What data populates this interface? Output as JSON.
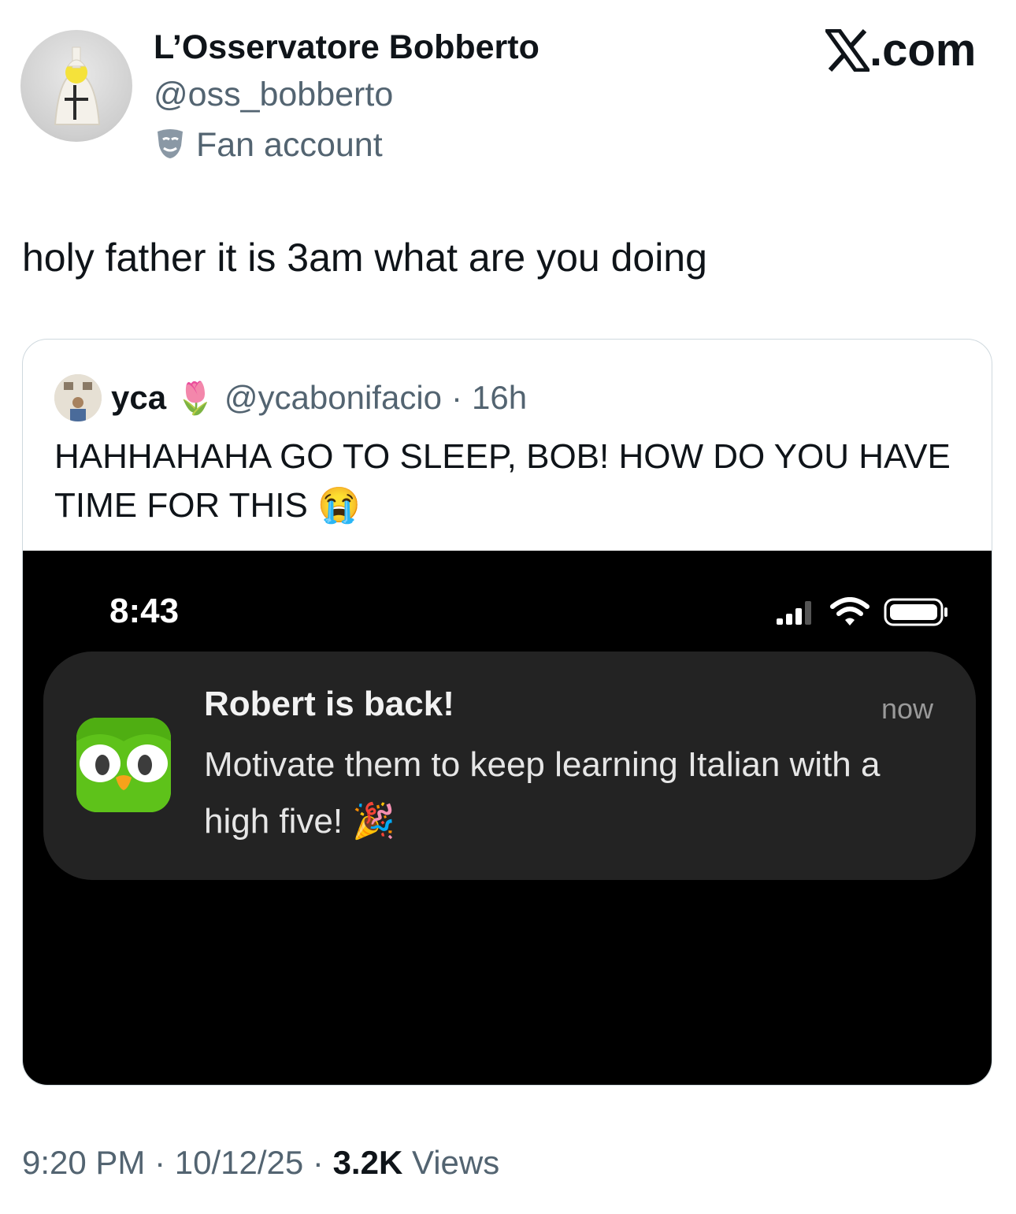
{
  "author": {
    "display_name": "L’Osservatore Bobberto",
    "handle": "@oss_bobberto",
    "label": "Fan account"
  },
  "brand": {
    "text": ".com"
  },
  "tweet": {
    "text": "holy father it is 3am what are you doing"
  },
  "quoted": {
    "name": "yca",
    "handle": "@ycabonifacio",
    "separator": "·",
    "age": "16h",
    "text": "HAHHAHAHA GO TO SLEEP, BOB! HOW DO YOU HAVE TIME FOR THIS",
    "emoji": "😭",
    "name_emoji": "🌷"
  },
  "screenshot": {
    "time": "8:43",
    "notification": {
      "title": "Robert is back!",
      "time": "now",
      "body": "Motivate them to keep learning Italian with a high five!",
      "emoji": "🎉"
    }
  },
  "footer": {
    "time": "9:20 PM",
    "sep1": " · ",
    "date": "10/12/25",
    "sep2": " · ",
    "views_count": "3.2K",
    "views_label": " Views"
  }
}
